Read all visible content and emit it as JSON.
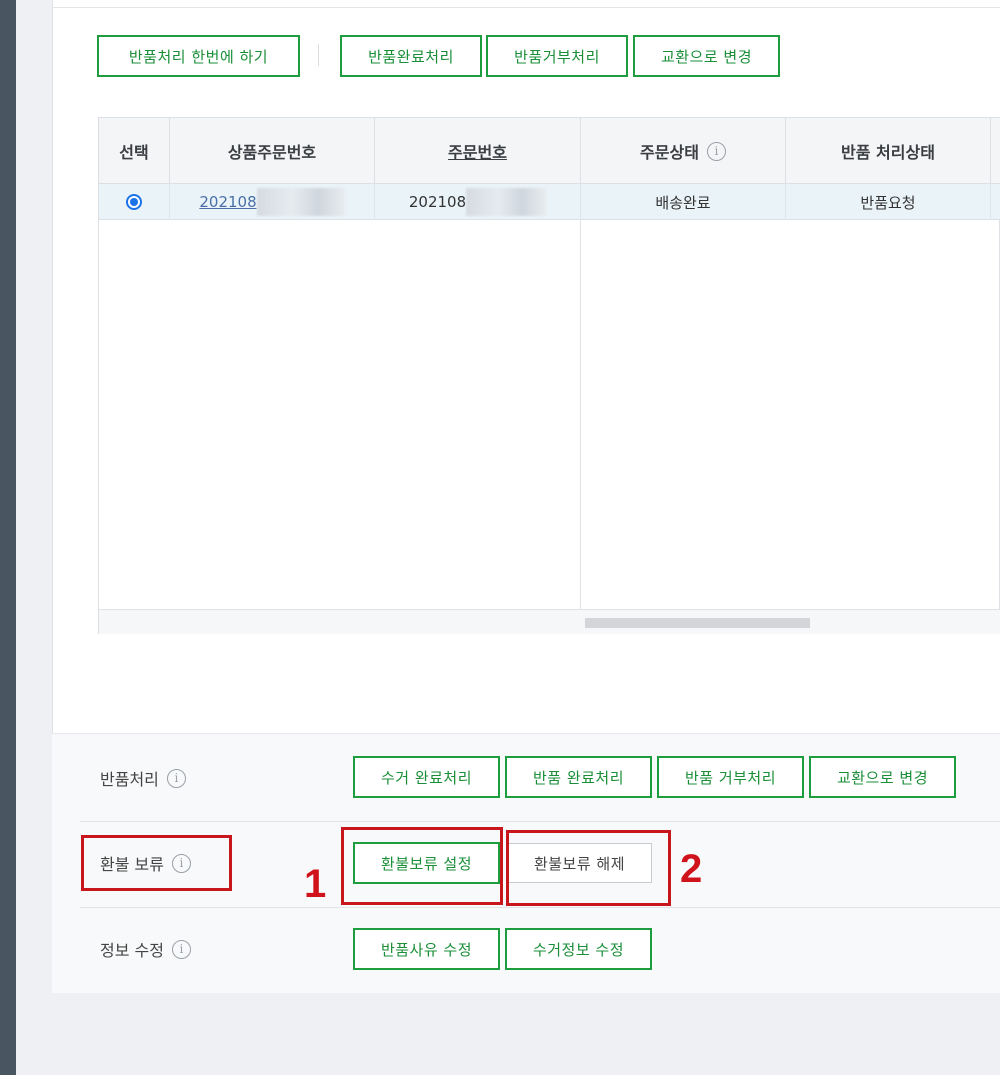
{
  "toolbar": {
    "batch_label": "반품처리 한번에 하기",
    "complete_label": "반품완료처리",
    "reject_label": "반품거부처리",
    "exchange_label": "교환으로 변경"
  },
  "grid": {
    "headers": {
      "select": "선택",
      "product_order_no": "상품주문번호",
      "order_no": "주문번호",
      "order_status": "주문상태",
      "return_status": "반품 처리상태"
    },
    "rows": [
      {
        "product_order_no": "202108",
        "order_no": "202108",
        "order_status": "배송완료",
        "return_status": "반품요청"
      }
    ]
  },
  "actions": {
    "return_process": {
      "label": "반품처리",
      "buttons": [
        "수거 완료처리",
        "반품 완료처리",
        "반품 거부처리",
        "교환으로 변경"
      ]
    },
    "refund_hold": {
      "label": "환불 보류",
      "buttons": [
        "환불보류 설정",
        "환불보류 해제"
      ]
    },
    "edit_info": {
      "label": "정보 수정",
      "buttons": [
        "반품사유 수정",
        "수거정보 수정"
      ]
    }
  },
  "annotations": {
    "num1": "1",
    "num2": "2",
    "color": "#d0121b"
  },
  "colors": {
    "accent_green": "#1e9d3f",
    "row_highlight": "#eaf4f8",
    "sidebar": "#4a5562"
  }
}
